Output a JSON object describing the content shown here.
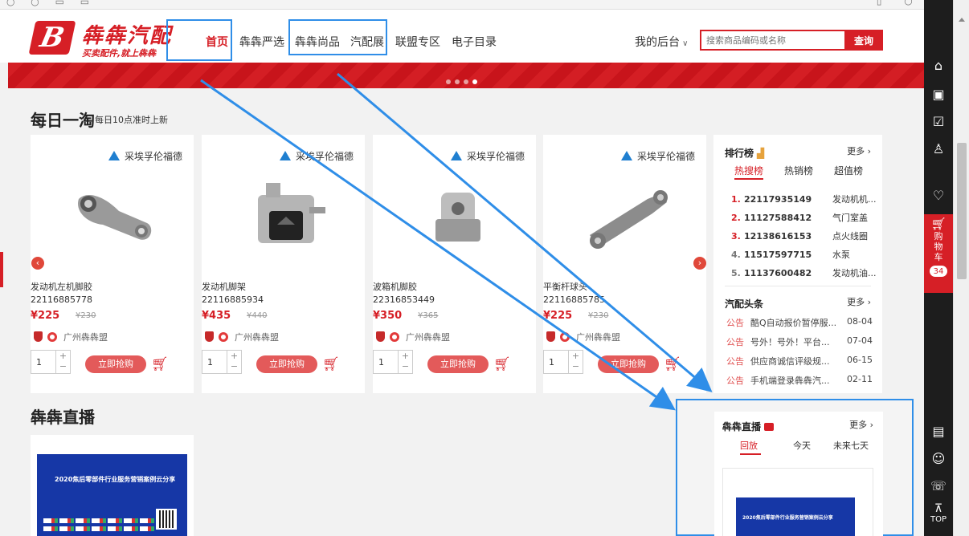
{
  "header": {
    "logo_name": "犇犇汽配",
    "logo_slogan": "买卖配件,就上犇犇",
    "nav": [
      "首页",
      "犇犇严选",
      "犇犇尚品",
      "汽配展",
      "联盟专区",
      "电子目录"
    ],
    "my_backend": "我的后台",
    "search_placeholder": "搜索商品编码或名称",
    "search_button": "查询"
  },
  "daily": {
    "title": "每日一淘",
    "subtitle": "每日10点准时上新"
  },
  "products": [
    {
      "brand": "采埃孚伦福德",
      "name": "发动机左机脚胶",
      "code": "22116885778",
      "price": "¥225",
      "old_price": "¥230",
      "store": "广州犇犇盟",
      "qty": "1",
      "buy": "立即抢购"
    },
    {
      "brand": "采埃孚伦福德",
      "name": "发动机脚架",
      "code": "22116885934",
      "price": "¥435",
      "old_price": "¥440",
      "store": "广州犇犇盟",
      "qty": "1",
      "buy": "立即抢购"
    },
    {
      "brand": "采埃孚伦福德",
      "name": "波箱机脚胶",
      "code": "22316853449",
      "price": "¥350",
      "old_price": "¥365",
      "store": "广州犇犇盟",
      "qty": "1",
      "buy": "立即抢购"
    },
    {
      "brand": "采埃孚伦福德",
      "name": "平衡杆球头",
      "code": "22116885785",
      "price": "¥225",
      "old_price": "¥230",
      "store": "广州犇犇盟",
      "qty": "1",
      "buy": "立即抢购"
    }
  ],
  "ranking": {
    "title": "排行榜",
    "more": "更多",
    "tabs": [
      "热搜榜",
      "热销榜",
      "超值榜"
    ],
    "rows": [
      {
        "n": "1.",
        "code": "22117935149",
        "name": "发动机机..."
      },
      {
        "n": "2.",
        "code": "11127588412",
        "name": "气门室盖"
      },
      {
        "n": "3.",
        "code": "12138616153",
        "name": "点火线圈"
      },
      {
        "n": "4.",
        "code": "11517597715",
        "name": "水泵"
      },
      {
        "n": "5.",
        "code": "11137600482",
        "name": "发动机油..."
      }
    ]
  },
  "news": {
    "title": "汽配头条",
    "more": "更多",
    "tag": "公告",
    "rows": [
      {
        "text": "酷Q自动报价暂停服...",
        "date": "08-04"
      },
      {
        "text": "号外！号外！平台...",
        "date": "07-04"
      },
      {
        "text": "供应商诚信评级规...",
        "date": "06-15"
      },
      {
        "text": "手机端登录犇犇汽...",
        "date": "02-11"
      }
    ]
  },
  "live": {
    "title": "犇犇直播",
    "thumb_title": "2020焦后零部件行业服务营销案例云分享",
    "panel_title": "犇犇直播",
    "more": "更多",
    "tabs": [
      "回放",
      "今天",
      "未来七天"
    ]
  },
  "sidebar": {
    "cart_label": "购物车",
    "cart_count": "34",
    "top_label": "TOP"
  },
  "colors": {
    "brand_red": "#d61f26",
    "highlight_blue": "#2f8ee8"
  }
}
